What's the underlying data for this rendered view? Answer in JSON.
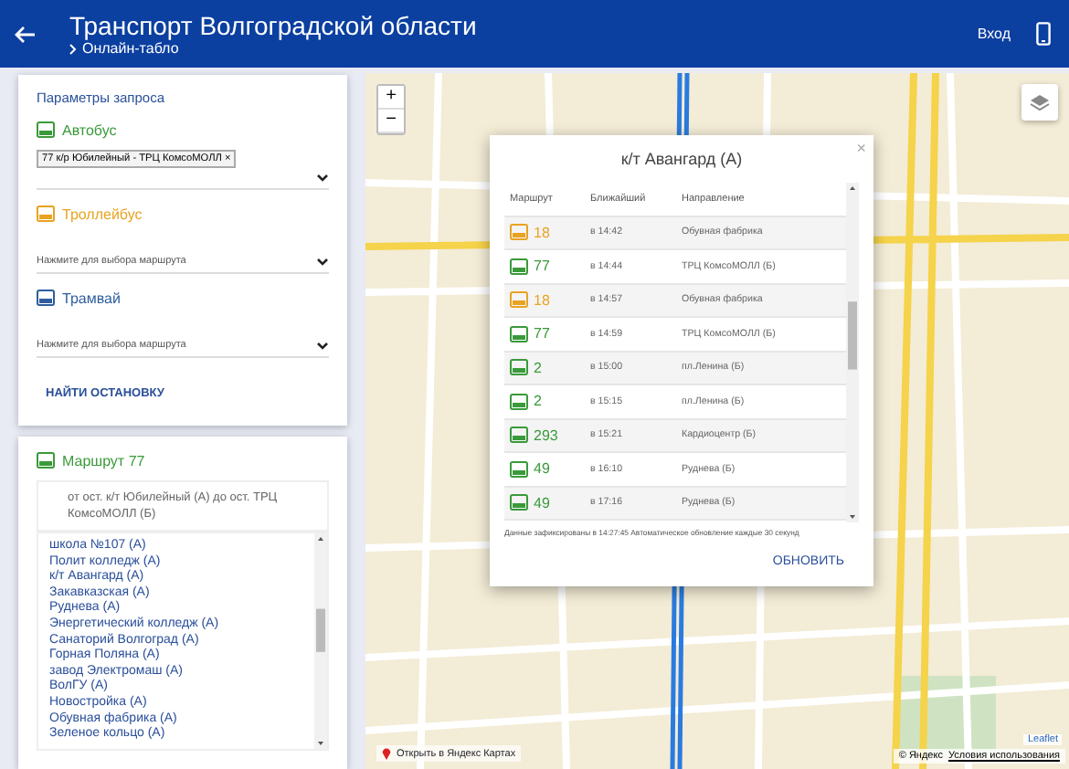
{
  "header": {
    "title": "Транспорт Волгоградской области",
    "breadcrumb": "Онлайн-табло",
    "login": "Вход"
  },
  "query": {
    "title": "Параметры запроса",
    "groups": [
      {
        "kind": "bus",
        "label": "Автобус",
        "chips": [
          {
            "text": "77 к/р Юбилейный - ТРЦ КомсоМОЛЛ",
            "remove": "×"
          }
        ]
      },
      {
        "kind": "trolley",
        "label": "Троллейбус",
        "placeholder": "Нажмите для выбора маршрута"
      },
      {
        "kind": "tram",
        "label": "Трамвай",
        "placeholder": "Нажмите для выбора маршрута"
      }
    ],
    "find_button": "НАЙТИ ОСТАНОВКУ"
  },
  "route": {
    "kind": "bus",
    "title": "Маршрут 77",
    "direction": "от ост. к/т Юбилейный (А) до ост. ТРЦ КомсоМОЛЛ (Б)",
    "stops": [
      "школа №107 (А)",
      "Полит колледж (А)",
      "к/т Авангард (А)",
      "Закавказская (А)",
      "Руднева (А)",
      "Энергетический колледж (А)",
      "Санаторий Волгоград (А)",
      "Горная Поляна (А)",
      "завод Электромаш (А)",
      "ВолГУ (А)",
      "Новостройка (А)",
      "Обувная фабрика (А)",
      "Зеленое кольцо (А)"
    ]
  },
  "map": {
    "open_link": "Открыть в Яндекс Картах",
    "attribution": "© Яндекс",
    "terms": "Условия использования",
    "leaflet": "Leaflet",
    "zoom_in": "+",
    "zoom_out": "−"
  },
  "popup": {
    "title": "к/т Авангард (А)",
    "close": "×",
    "columns": [
      "Маршрут",
      "Ближайший",
      "Направление"
    ],
    "rows": [
      {
        "kind": "trolley",
        "route": "18",
        "time": "в 14:42",
        "direction": "Обувная фабрика"
      },
      {
        "kind": "bus",
        "route": "77",
        "time": "в 14:44",
        "direction": "ТРЦ КомсоМОЛЛ (Б)"
      },
      {
        "kind": "trolley",
        "route": "18",
        "time": "в 14:57",
        "direction": "Обувная фабрика"
      },
      {
        "kind": "bus",
        "route": "77",
        "time": "в 14:59",
        "direction": "ТРЦ КомсоМОЛЛ (Б)"
      },
      {
        "kind": "bus",
        "route": "2",
        "time": "в 15:00",
        "direction": "пл.Ленина (Б)"
      },
      {
        "kind": "bus",
        "route": "2",
        "time": "в 15:15",
        "direction": "пл.Ленина (Б)"
      },
      {
        "kind": "bus",
        "route": "293",
        "time": "в 15:21",
        "direction": "Кардиоцентр (Б)"
      },
      {
        "kind": "bus",
        "route": "49",
        "time": "в 16:10",
        "direction": "Руднева (Б)"
      },
      {
        "kind": "bus",
        "route": "49",
        "time": "в 17:16",
        "direction": "Руднева (Б)"
      }
    ],
    "note": "Данные зафиксированы в 14:27:45 Автоматическое обновление каждые 30 секунд",
    "refresh": "ОБНОВИТЬ"
  }
}
